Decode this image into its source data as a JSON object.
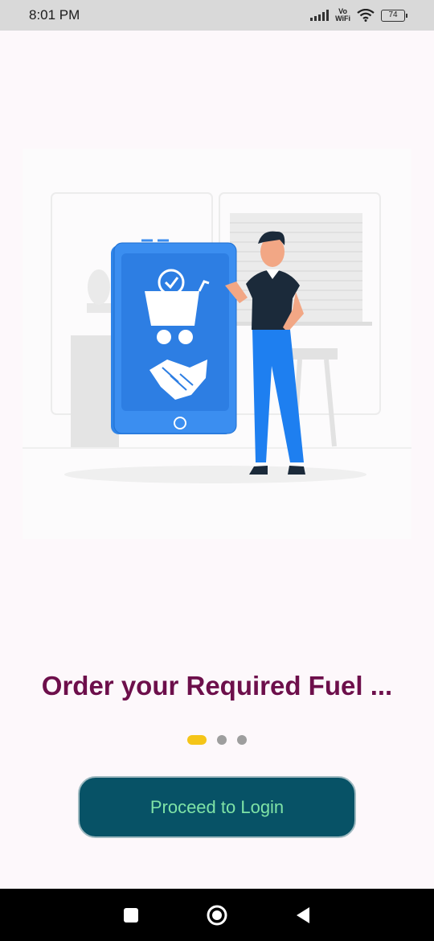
{
  "status_bar": {
    "time": "8:01 PM",
    "vowifi_top": "Vo",
    "vowifi_bottom": "WiFi",
    "battery": "74"
  },
  "illustration": {
    "icon": "shopping-handshake-illustration"
  },
  "onboarding": {
    "title": "Order your Required Fuel ...",
    "page_index": 1,
    "page_count": 3
  },
  "actions": {
    "proceed_label": "Proceed to Login"
  },
  "nav": {
    "square_icon": "recent-apps-icon",
    "circle_icon": "home-icon",
    "triangle_icon": "back-icon"
  },
  "colors": {
    "title": "#6d0f4b",
    "button_bg": "#075266",
    "button_text": "#7fe3a6",
    "active_dot": "#f5c518",
    "inactive_dot": "#9e9e9e",
    "phone_blue": "#1e7ff0"
  }
}
